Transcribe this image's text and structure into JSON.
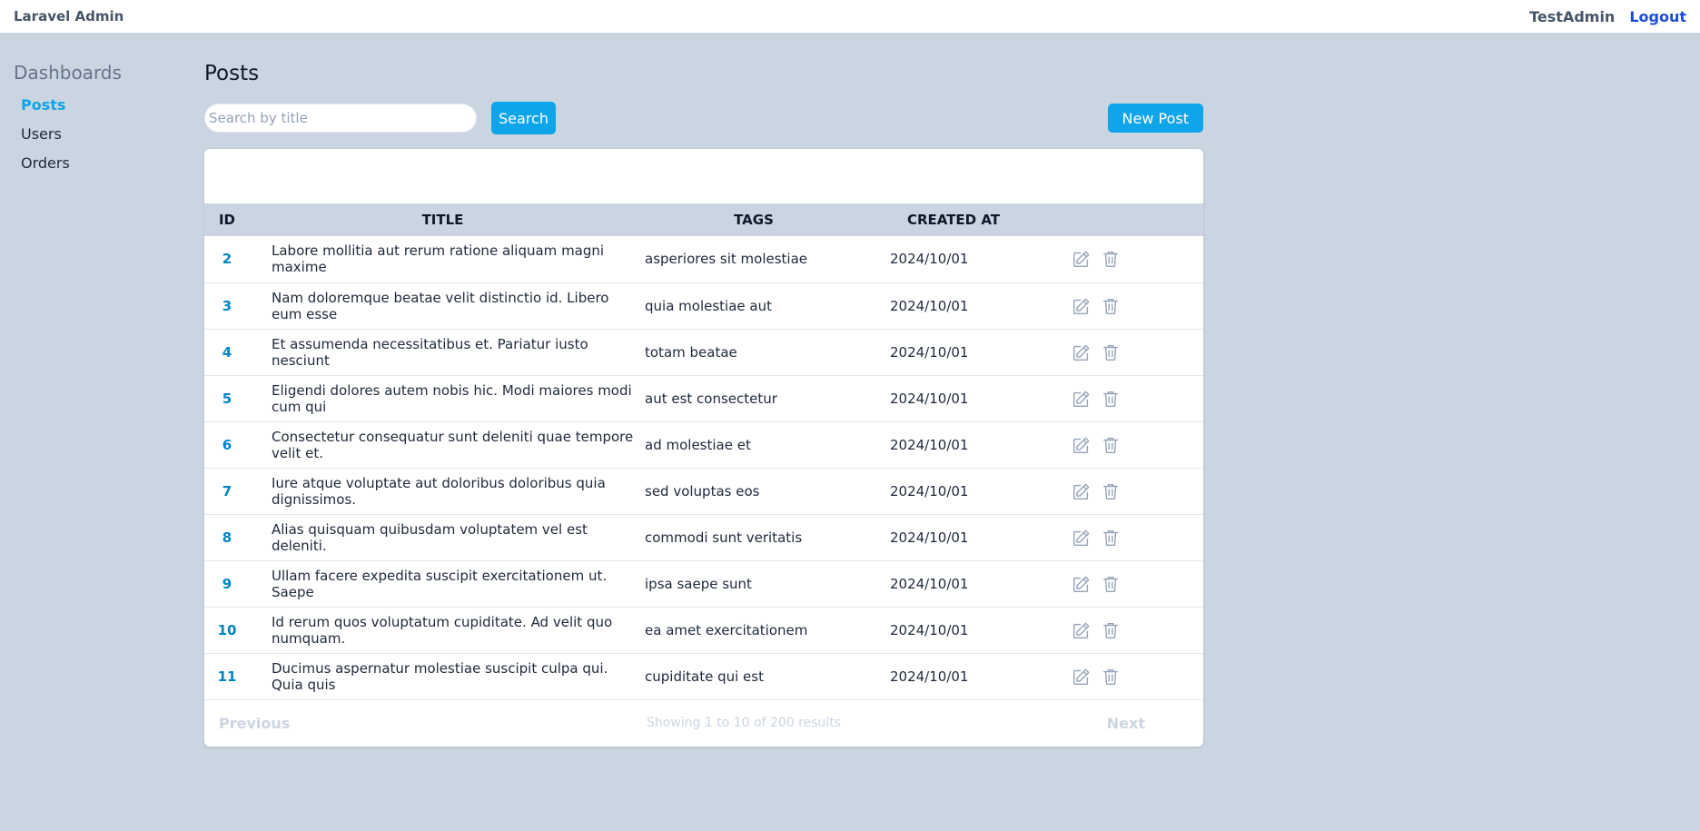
{
  "topbar": {
    "brand": "Laravel Admin",
    "user": "TestAdmin",
    "logout": "Logout"
  },
  "sidebar": {
    "heading": "Dashboards",
    "items": [
      {
        "label": "Posts",
        "active": true
      },
      {
        "label": "Users",
        "active": false
      },
      {
        "label": "Orders",
        "active": false
      }
    ]
  },
  "main": {
    "title": "Posts",
    "search": {
      "placeholder": "Search by title",
      "value": "",
      "button": "Search"
    },
    "new_post": "New Post"
  },
  "table": {
    "headers": {
      "id": "ID",
      "title": "TITLE",
      "tags": "TAGS",
      "created": "CREATED AT"
    },
    "rows": [
      {
        "id": "2",
        "title": "Labore mollitia aut rerum ratione aliquam magni maxime",
        "tags": "asperiores sit molestiae",
        "created": "2024/10/01"
      },
      {
        "id": "3",
        "title": "Nam doloremque beatae velit distinctio id. Libero eum esse",
        "tags": "quia molestiae aut",
        "created": "2024/10/01"
      },
      {
        "id": "4",
        "title": "Et assumenda necessitatibus et. Pariatur iusto nesciunt",
        "tags": "totam beatae",
        "created": "2024/10/01"
      },
      {
        "id": "5",
        "title": "Eligendi dolores autem nobis hic. Modi maiores modi cum qui",
        "tags": "aut est consectetur",
        "created": "2024/10/01"
      },
      {
        "id": "6",
        "title": "Consectetur consequatur sunt deleniti quae tempore velit et.",
        "tags": "ad molestiae et",
        "created": "2024/10/01"
      },
      {
        "id": "7",
        "title": "Iure atque voluptate aut doloribus doloribus quia dignissimos.",
        "tags": "sed voluptas eos",
        "created": "2024/10/01"
      },
      {
        "id": "8",
        "title": "Alias quisquam quibusdam voluptatem vel est deleniti.",
        "tags": "commodi sunt veritatis",
        "created": "2024/10/01"
      },
      {
        "id": "9",
        "title": "Ullam facere expedita suscipit exercitationem ut. Saepe",
        "tags": "ipsa saepe sunt",
        "created": "2024/10/01"
      },
      {
        "id": "10",
        "title": "Id rerum quos voluptatum cupiditate. Ad velit quo numquam.",
        "tags": "ea amet exercitationem",
        "created": "2024/10/01"
      },
      {
        "id": "11",
        "title": "Ducimus aspernatur molestiae suscipit culpa qui. Quia quis",
        "tags": "cupiditate qui est",
        "created": "2024/10/01"
      }
    ]
  },
  "pager": {
    "prev": "Previous",
    "info": "Showing 1 to 10 of 200 results",
    "next": "Next"
  },
  "icons": {
    "edit": "pencil-square-icon",
    "delete": "trash-icon"
  },
  "colors": {
    "accent": "#0ea5e9",
    "background": "#cbd5e1",
    "link": "#1d4ed8"
  }
}
